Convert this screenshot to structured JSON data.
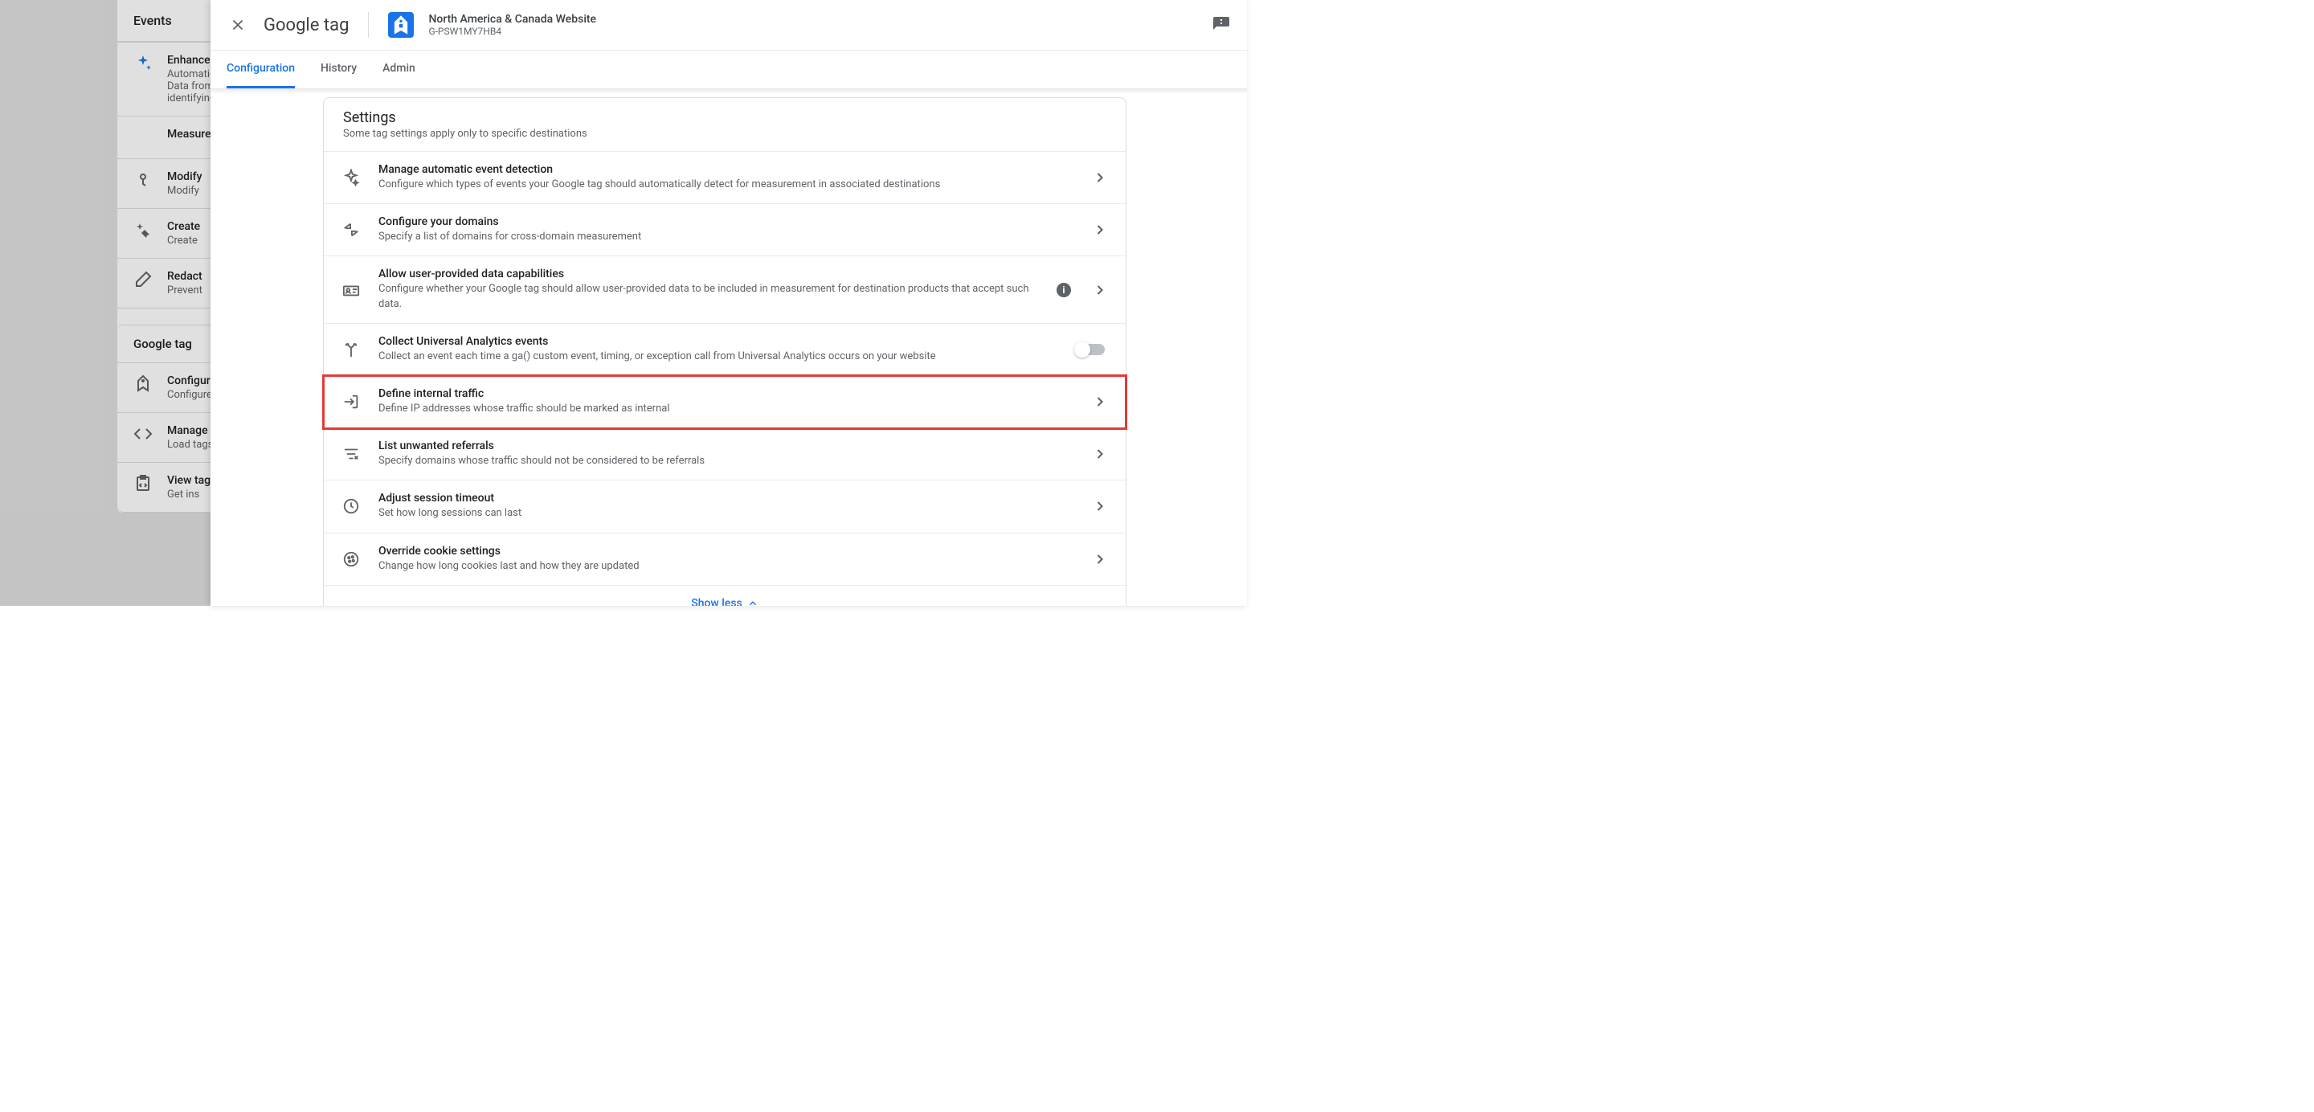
{
  "bg": {
    "events_title": "Events",
    "rows": [
      {
        "title": "Enhanced",
        "sub": "Automatically\nData from on\nidentifying"
      },
      {
        "title": "Measurement"
      },
      {
        "title": "Modify",
        "sub": "Modify"
      },
      {
        "title": "Create",
        "sub": "Create"
      },
      {
        "title": "Redact",
        "sub": "Prevent"
      }
    ],
    "gtag_title": "Google tag",
    "gtag_rows": [
      {
        "title": "Configure",
        "sub": "Configure"
      },
      {
        "title": "Manage",
        "sub": "Load tags"
      },
      {
        "title": "View tag",
        "sub": "Get ins"
      }
    ]
  },
  "overlay": {
    "brand": "Google tag",
    "property_name": "North America & Canada Website",
    "property_id": "G-PSW1MY7HB4",
    "tabs": [
      {
        "label": "Configuration",
        "active": true
      },
      {
        "label": "History",
        "active": false
      },
      {
        "label": "Admin",
        "active": false
      }
    ],
    "settings_title": "Settings",
    "settings_sub": "Some tag settings apply only to specific destinations",
    "items": [
      {
        "icon": "sparkle",
        "title": "Manage automatic event detection",
        "sub": "Configure which types of events your Google tag should automatically detect for measurement in associated destinations",
        "accessory": "chevron"
      },
      {
        "icon": "arrows-in",
        "title": "Configure your domains",
        "sub": "Specify a list of domains for cross-domain measurement",
        "accessory": "chevron"
      },
      {
        "icon": "id-card",
        "title": "Allow user-provided data capabilities",
        "sub": "Configure whether your Google tag should allow user-provided data to be included in measurement for destination products that accept such data.",
        "accessory": "info-chevron"
      },
      {
        "icon": "fork",
        "title": "Collect Universal Analytics events",
        "sub": "Collect an event each time a ga() custom event, timing, or exception call from Universal Analytics occurs on your website",
        "accessory": "toggle"
      },
      {
        "icon": "login",
        "title": "Define internal traffic",
        "sub": "Define IP addresses whose traffic should be marked as internal",
        "accessory": "chevron",
        "highlighted": true
      },
      {
        "icon": "filter-x",
        "title": "List unwanted referrals",
        "sub": "Specify domains whose traffic should not be considered to be referrals",
        "accessory": "chevron"
      },
      {
        "icon": "clock",
        "title": "Adjust session timeout",
        "sub": "Set how long sessions can last",
        "accessory": "chevron"
      },
      {
        "icon": "cookie",
        "title": "Override cookie settings",
        "sub": "Change how long cookies last and how they are updated",
        "accessory": "chevron"
      }
    ],
    "show_less": "Show less"
  }
}
